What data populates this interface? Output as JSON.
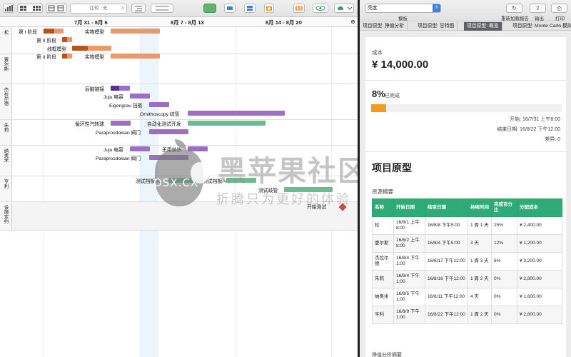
{
  "toolbar": {
    "compare_label": "比较 : 无"
  },
  "timeline": {
    "weeks": [
      "7月 31 - 8月 6",
      "8月 7 - 8月 13",
      "8月 14 - 8月 20"
    ]
  },
  "resources": [
    {
      "name": "松"
    },
    {
      "name": "壹尔斯"
    },
    {
      "name": "杰拉尔德"
    },
    {
      "name": "朱莉"
    },
    {
      "name": "纳奥米"
    },
    {
      "name": "亨利"
    },
    {
      "name": "设施定约"
    }
  ],
  "tasks": [
    {
      "label": "第 I 阶段"
    },
    {
      "label": "实物模型"
    },
    {
      "label": "第 II 阶段"
    },
    {
      "label": "线框模型"
    },
    {
      "label": "第 II 阶段"
    },
    {
      "label": "实物模型"
    },
    {
      "label": "后脑链接"
    },
    {
      "label": "Juju 电容"
    },
    {
      "label": "Eigengrau 挡板"
    },
    {
      "label": "Ornithoscopy 歧管"
    },
    {
      "label": "循环性汽转球"
    },
    {
      "label": "自动化测试开发"
    },
    {
      "label": "Paraprosdokian 阀门"
    },
    {
      "label": "Juju 电容"
    },
    {
      "label": "无用装饰"
    },
    {
      "label": "Paraprosdokian 阀门"
    },
    {
      "label": "测试挡板 #1"
    },
    {
      "label": "测试挡板 #2"
    },
    {
      "label": "测试歧管"
    },
    {
      "label": "开始测试"
    }
  ],
  "inspector": {
    "template_value": "亮度",
    "template_label": "模板",
    "reload_label": "重新加载报告",
    "export_label": "输出",
    "print_label": "打印",
    "tabs": [
      "项目原型: 挣值分析",
      "项目原型: 甘特图",
      "项目原型: 概览",
      "项目原型: Monte Carlo 模拟"
    ]
  },
  "report": {
    "cost_label": "成本",
    "cost_value": "¥ 14,000.00",
    "percent": "8%",
    "percent_value": 8,
    "percent_suffix": "已完成",
    "start_text": "开始: 16/7/31 上午8:00",
    "end_text": "结束日期: 16/8/22 下午12:00",
    "variance_text": "差异: 0",
    "project_title": "项目原型",
    "resource_summary": "资源摘要",
    "table": {
      "headers": [
        "名称",
        "开始日期",
        "结束日期",
        "持续时间",
        "完成百分比",
        "分配成本"
      ],
      "rows": [
        [
          "松",
          "16/8/1 上午8:00",
          "16/8/8 下午5:00",
          "1 周 1 天",
          "25%",
          "¥ 2,400.00"
        ],
        [
          "壹尔斯",
          "16/8/2 上午8:00",
          "16/8/4 下午5:00",
          "3 天",
          "12%",
          "¥ 1,200.00"
        ],
        [
          "杰拉尔德",
          "16/8/4 下午1:00",
          "16/8/17 下午12:00",
          "1 周 3 天",
          "6%",
          "¥ 3,200.00"
        ],
        [
          "朱莉",
          "16/8/4 下午1:00",
          "16/8/16 下午12:00",
          "1 周 2 天",
          "0%",
          "¥ 2,800.00"
        ],
        [
          "纳奥米",
          "16/8/5 下午1:00",
          "16/8/11 下午12:00",
          "4 天",
          "0%",
          "¥ 1,600.00"
        ],
        [
          "亨利",
          "16/8/9 下午1:00",
          "16/8/22 下午12:00",
          "1 周 2 天",
          "0%",
          "¥ 2,800.00"
        ]
      ]
    },
    "next_section": "挣值分析摘要"
  },
  "watermark": {
    "osx": "OSX.CX",
    "brand": "黑苹果社区",
    "slogan": "折腾只为更好的体验"
  },
  "colors": {
    "phase_orange": "#b9521c",
    "light_orange": "#e89a6e",
    "purple": "#9b6fc3",
    "dark_purple": "#5c2f95",
    "green": "#6abb8f",
    "milestone": "#c34b4b",
    "table_header": "#2eab76",
    "progress": "#f39c1f"
  }
}
